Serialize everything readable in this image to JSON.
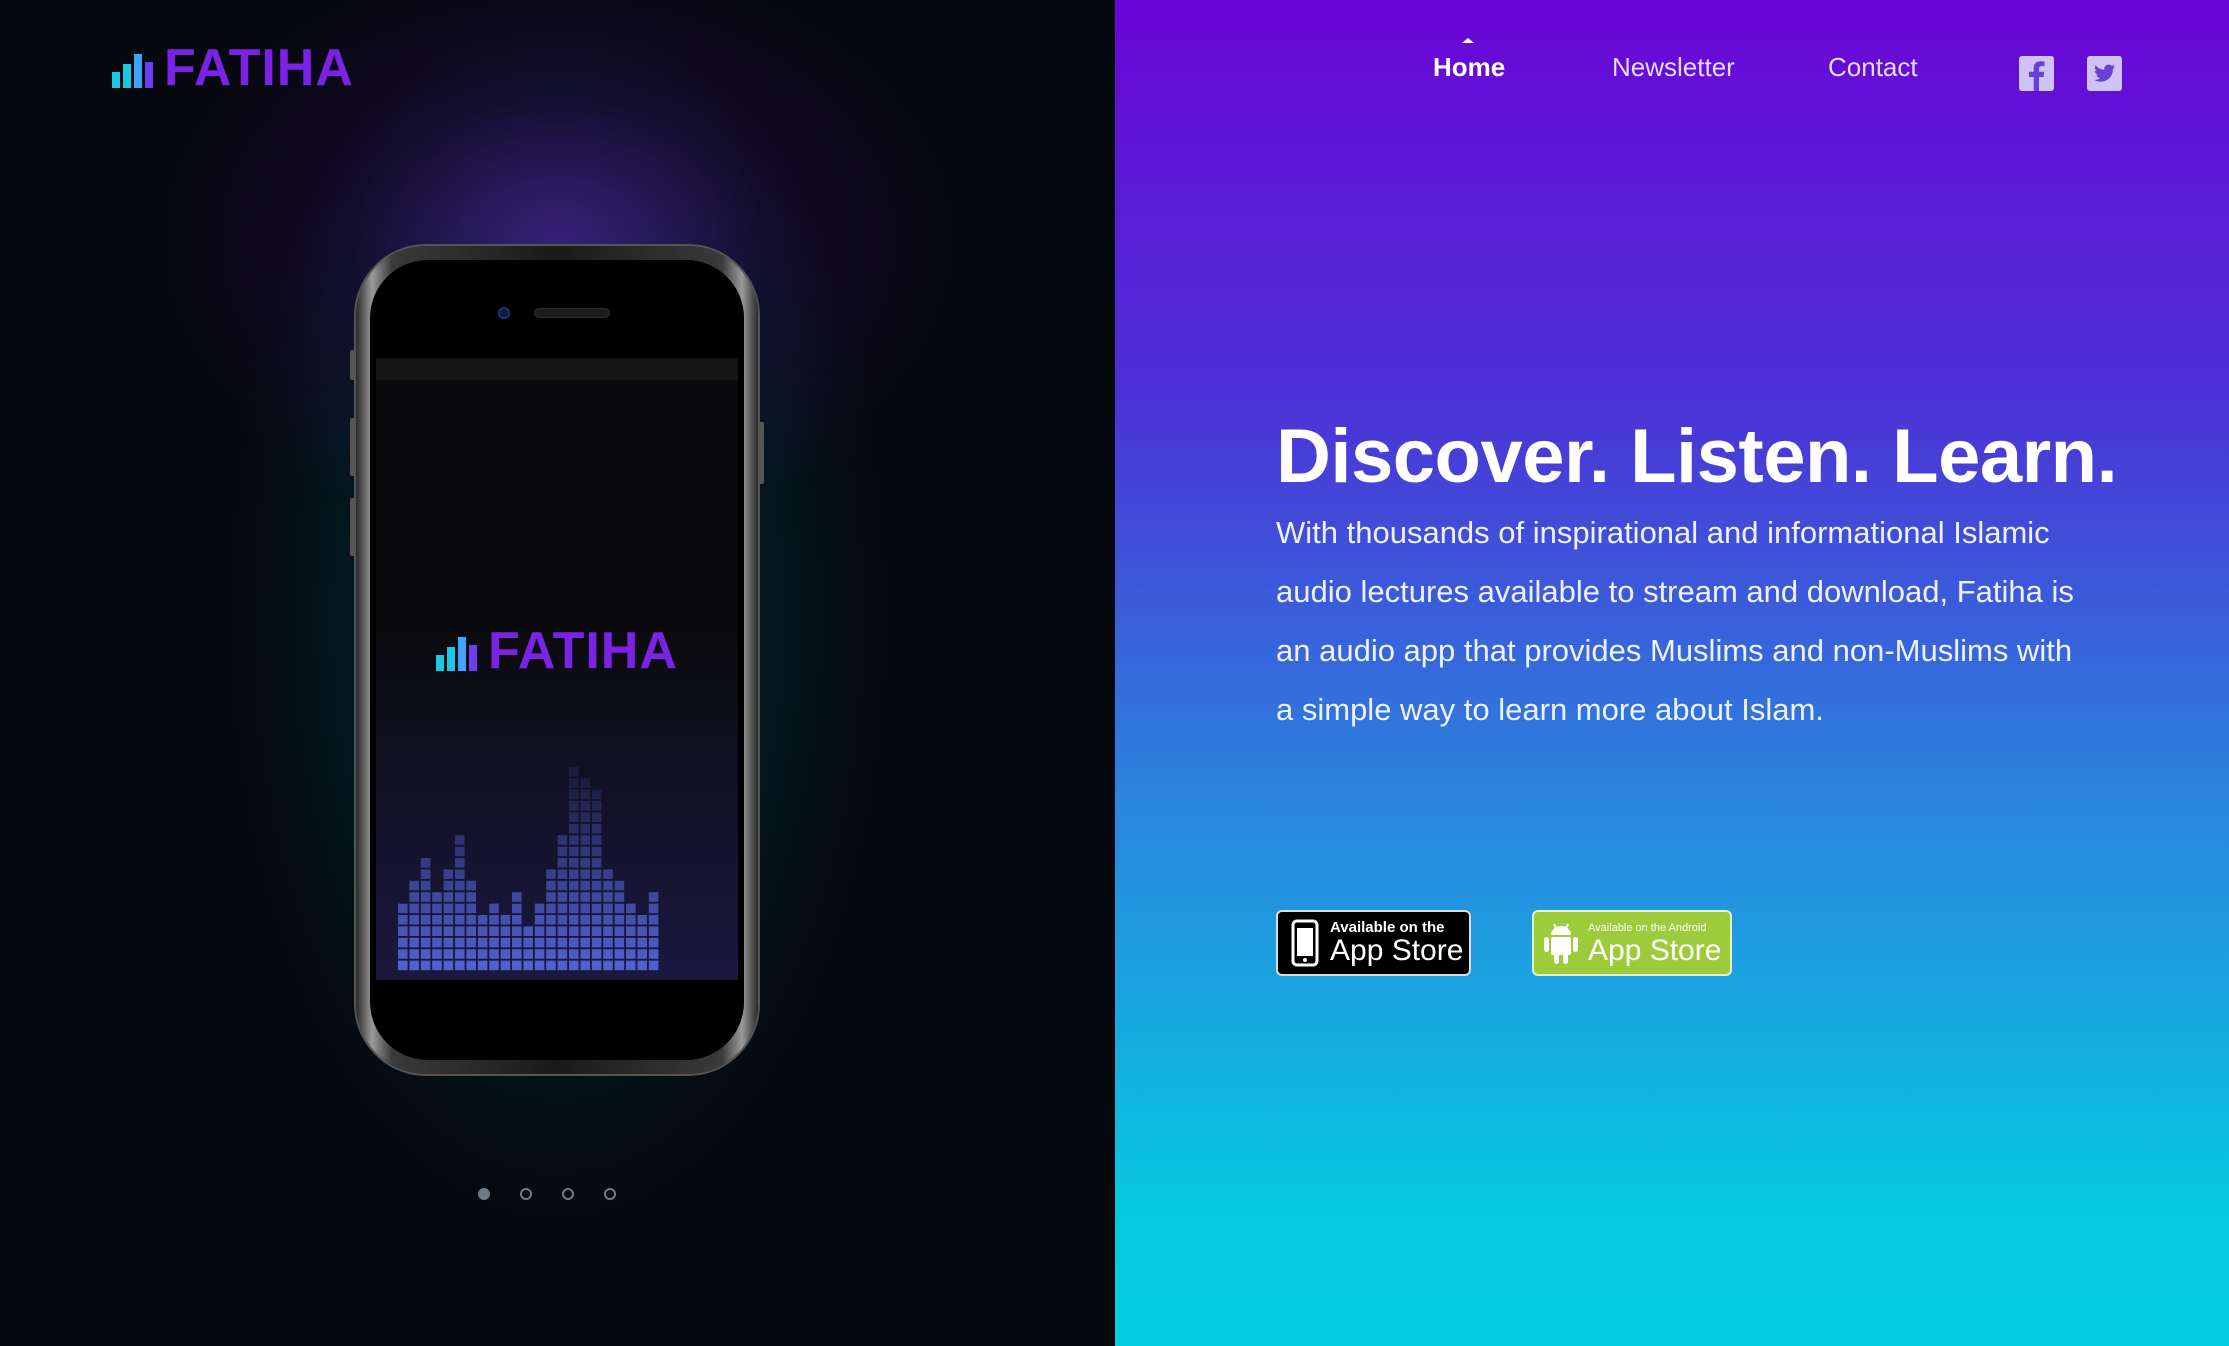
{
  "brand": {
    "name": "FATIHA",
    "color": "#7a22e6",
    "bar_colors": [
      "#18c8e6",
      "#3fa4ff",
      "#6f3df0",
      "#8a2be2"
    ]
  },
  "nav": {
    "items": [
      {
        "label": "Home",
        "active": true
      },
      {
        "label": "Newsletter",
        "active": false
      },
      {
        "label": "Contact",
        "active": false
      }
    ],
    "social": [
      {
        "name": "facebook-icon"
      },
      {
        "name": "twitter-icon"
      }
    ]
  },
  "hero": {
    "headline": "Discover. Listen. Learn.",
    "description": "With thousands of inspirational and informational Islamic audio lectures available to stream and download, Fatiha is an audio app that provides Muslims and non-Muslims with a simple way to learn more about Islam."
  },
  "badges": {
    "ios": {
      "small": "Available on the",
      "big": "App Store"
    },
    "android": {
      "small": "Available on the Android",
      "big": "App Store"
    }
  },
  "carousel": {
    "count": 4,
    "active_index": 0
  },
  "colors": {
    "gradient_top": "#6a05d6",
    "gradient_bottom": "#02cfe0",
    "android_green": "#9ccc3c",
    "equalizer": "#5b6ee8"
  }
}
